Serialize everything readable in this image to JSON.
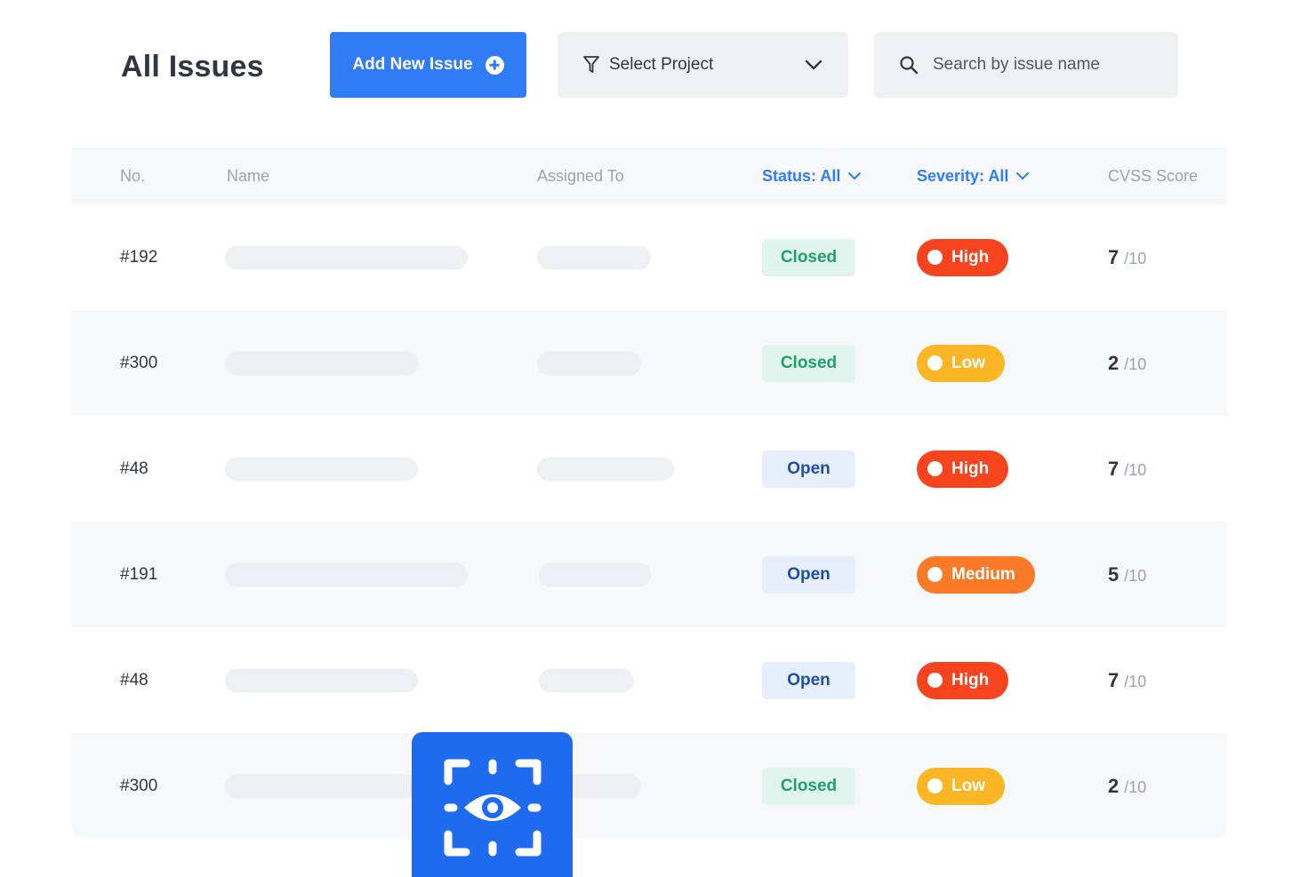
{
  "header": {
    "title": "All Issues",
    "add_button_label": "Add New Issue",
    "project_select_label": "Select Project",
    "search_placeholder": "Search by issue name"
  },
  "table": {
    "columns": {
      "no": "No.",
      "name": "Name",
      "assigned_to": "Assigned To",
      "status_filter": "Status: All",
      "severity_filter": "Severity: All",
      "cvss": "CVSS Score"
    },
    "score_max": "/10",
    "rows": [
      {
        "no": "#192",
        "status": "Closed",
        "severity": "High",
        "score": "7"
      },
      {
        "no": "#300",
        "status": "Closed",
        "severity": "Low",
        "score": "2"
      },
      {
        "no": "#48",
        "status": "Open",
        "severity": "High",
        "score": "7"
      },
      {
        "no": "#191",
        "status": "Open",
        "severity": "Medium",
        "score": "5"
      },
      {
        "no": "#48",
        "status": "Open",
        "severity": "High",
        "score": "7"
      },
      {
        "no": "#300",
        "status": "Closed",
        "severity": "Low",
        "score": "2"
      }
    ]
  },
  "colors": {
    "primary": "#2f7cf6",
    "severity_high": "#f8431f",
    "severity_medium": "#fb7a28",
    "severity_low": "#fbb625",
    "status_closed": "#22a06b",
    "status_open": "#1e4fa8"
  },
  "icons": {
    "add": "plus-circle-icon",
    "filter": "filter-icon",
    "dropdown": "chevron-down-icon",
    "search": "search-icon",
    "badge": "eye-scan-icon"
  }
}
